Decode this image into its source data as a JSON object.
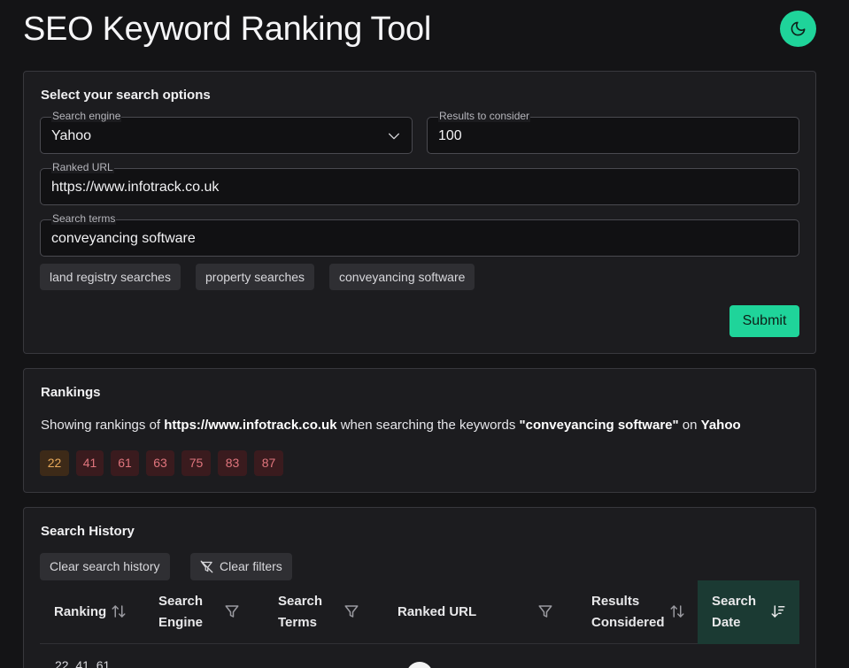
{
  "app": {
    "title": "SEO Keyword Ranking Tool"
  },
  "search_options": {
    "title": "Select your search options",
    "search_engine": {
      "label": "Search engine",
      "value": "Yahoo"
    },
    "results_to_consider": {
      "label": "Results to consider",
      "value": "100"
    },
    "ranked_url": {
      "label": "Ranked URL",
      "value": "https://www.infotrack.co.uk"
    },
    "search_terms": {
      "label": "Search terms",
      "value": "conveyancing software"
    },
    "suggestions": [
      "land registry searches",
      "property searches",
      "conveyancing software"
    ],
    "submit_label": "Submit"
  },
  "rankings": {
    "title": "Rankings",
    "summary": {
      "prefix": "Showing rankings of ",
      "url": "https://www.infotrack.co.uk",
      "middle": " when searching the keywords ",
      "keywords": "\"conveyancing software\"",
      "on": " on ",
      "engine": "Yahoo"
    },
    "positions": [
      "22",
      "41",
      "61",
      "63",
      "75",
      "83",
      "87"
    ]
  },
  "history": {
    "title": "Search History",
    "clear_history_label": "Clear search history",
    "clear_filters_label": "Clear filters",
    "columns": {
      "ranking": "Ranking",
      "engine_1": "Search",
      "engine_2": "Engine",
      "terms_1": "Search",
      "terms_2": "Terms",
      "url": "Ranked URL",
      "results_1": "Results",
      "results_2": "Considered",
      "date_1": "Search",
      "date_2": "Date"
    },
    "first_row_ranking": "22, 41, 61"
  },
  "colors": {
    "accent": "#1fd49a",
    "background": "#141416",
    "card": "#1c1c1f",
    "badge_good": "#e8a95a",
    "badge_bad": "#e0757d",
    "active_header": "#1b3a33"
  },
  "icons": {
    "theme_toggle": "moon-icon",
    "select": "chevron-down-icon",
    "clear_filters": "filter-off-icon",
    "filter": "filter-icon",
    "sort": "sort-arrows-icon",
    "sort_active": "sort-descending-icon"
  }
}
